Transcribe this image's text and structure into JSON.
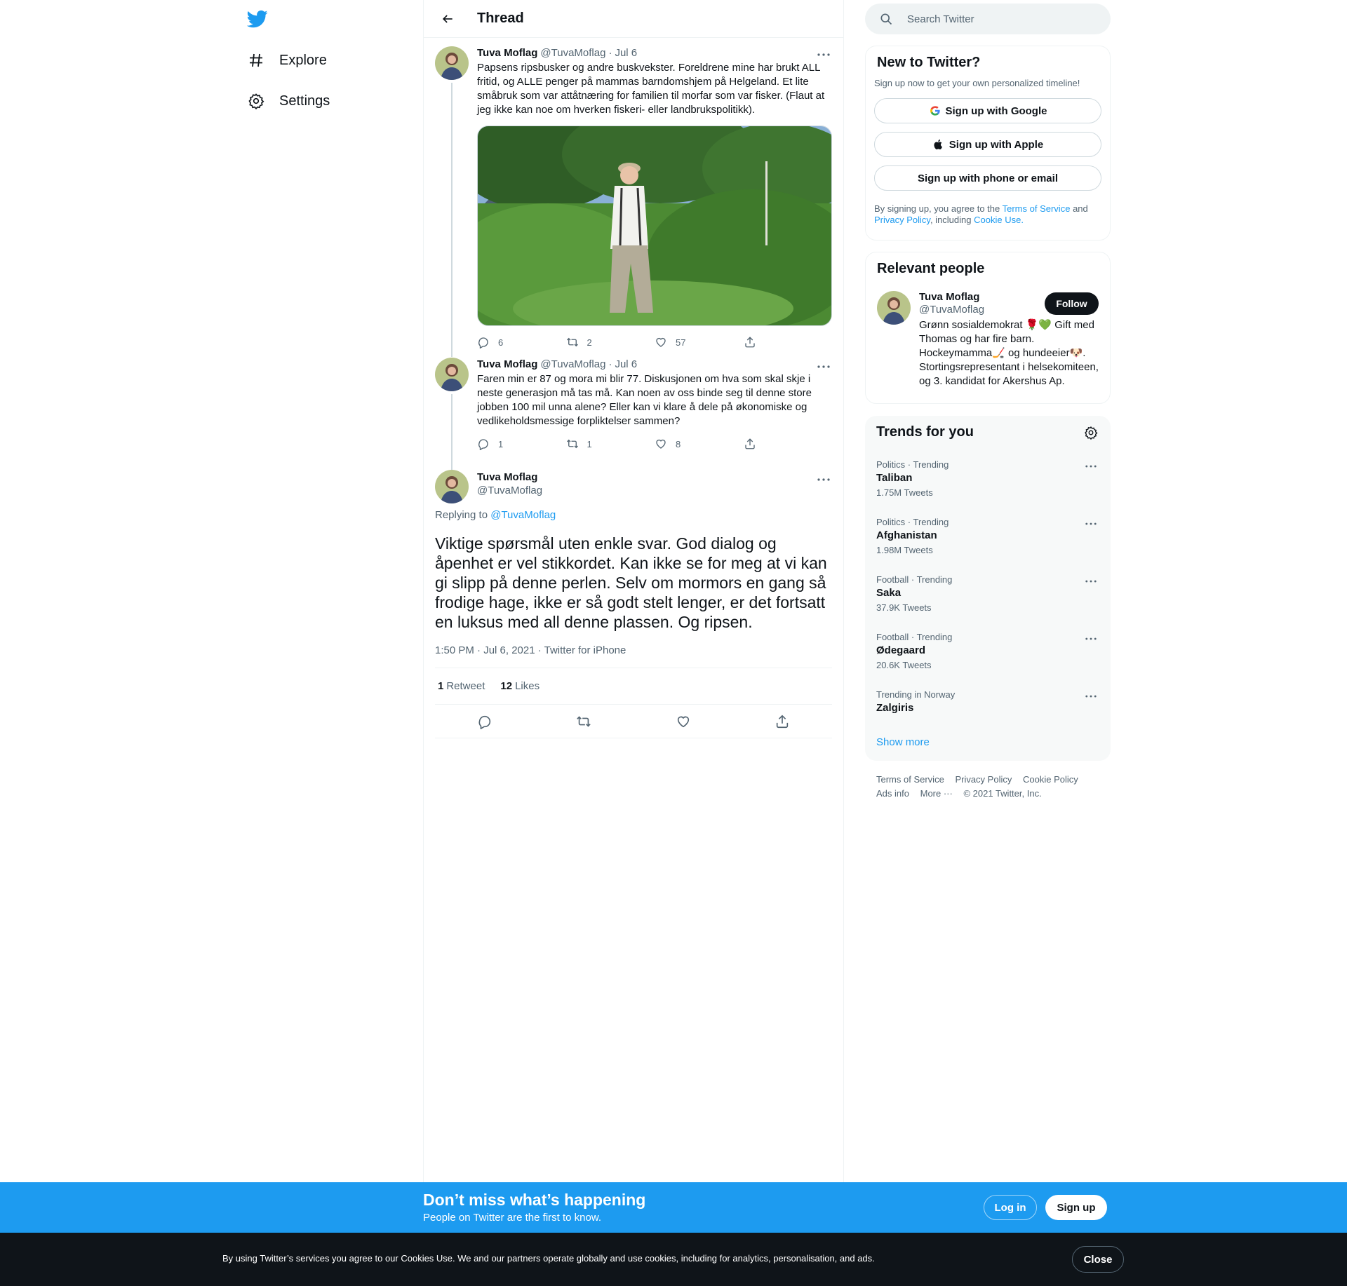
{
  "colors": {
    "brand": "#1d9bf0",
    "text": "#0f1419",
    "muted": "#536471",
    "border": "#eff3f4"
  },
  "nav": {
    "logo": "twitter-bird-icon",
    "items": [
      {
        "label": "Explore",
        "icon": "hashtag-icon"
      },
      {
        "label": "Settings",
        "icon": "gear-icon"
      }
    ]
  },
  "header": {
    "title": "Thread"
  },
  "tweets": [
    {
      "name": "Tuva Moflag",
      "handle": "@TuvaMoflag",
      "sep": "·",
      "date": "Jul 6",
      "text": "Papsens ripsbusker og andre buskvekster. Foreldrene mine har brukt ALL fritid, og ALLE penger på mammas barndomshjem på Helgeland. Et lite småbruk som var attåtnæring for familien til morfar som var fisker. (Flaut at jeg ikke kan noe om hverken fiskeri- eller landbrukspolitikk).",
      "replies": "6",
      "retweets": "2",
      "likes": "57"
    },
    {
      "name": "Tuva Moflag",
      "handle": "@TuvaMoflag",
      "sep": "·",
      "date": "Jul 6",
      "text": "Faren min er 87 og mora mi blir 77. Diskusjonen om hva som skal skje i neste generasjon må tas må. Kan noen av oss binde seg til denne store jobben 100 mil unna alene? Eller kan vi klare å dele på økonomiske og vedlikeholdsmessige forpliktelser sammen?",
      "replies": "1",
      "retweets": "1",
      "likes": "8"
    }
  ],
  "focal": {
    "name": "Tuva Moflag",
    "handle": "@TuvaMoflag",
    "replying_prefix": "Replying to",
    "replying_handle": "@TuvaMoflag",
    "text": "Viktige spørsmål uten enkle svar. God dialog og åpenhet er vel stikkordet. Kan ikke se for meg at vi kan gi slipp på denne perlen. Selv om mormors en gang så frodige hage, ikke er så godt stelt lenger, er det fortsatt en luksus med all denne plassen. Og ripsen.",
    "meta": "1:50 PM · Jul 6, 2021 · Twitter for iPhone",
    "retweet_count": "1",
    "retweet_label": "Retweet",
    "like_count": "12",
    "like_label": "Likes"
  },
  "search": {
    "placeholder": "Search Twitter"
  },
  "new_to_twitter": {
    "title": "New to Twitter?",
    "subtitle": "Sign up now to get your own personalized timeline!",
    "google": "Sign up with Google",
    "apple": "Sign up with Apple",
    "phone": "Sign up with phone or email",
    "legal_1": "By signing up, you agree to the",
    "tos": "Terms of Service",
    "legal_2": "and",
    "privacy": "Privacy Policy",
    "legal_3": ", including",
    "cookie": "Cookie Use."
  },
  "relevant": {
    "title": "Relevant people",
    "name": "Tuva Moflag",
    "handle": "@TuvaMoflag",
    "follow": "Follow",
    "bio": "Grønn sosialdemokrat 🌹💚 Gift med Thomas og har fire barn. Hockeymamma🏒 og hundeeier🐶. Stortingsrepresentant i helsekomiteen, og 3. kandidat for Akershus Ap."
  },
  "trends": {
    "title": "Trends for you",
    "items": [
      {
        "meta": "Politics · Trending",
        "topic": "Taliban",
        "count": "1.75M Tweets"
      },
      {
        "meta": "Politics · Trending",
        "topic": "Afghanistan",
        "count": "1.98M Tweets"
      },
      {
        "meta": "Football · Trending",
        "topic": "Saka",
        "count": "37.9K Tweets"
      },
      {
        "meta": "Football · Trending",
        "topic": "Ødegaard",
        "count": "20.6K Tweets"
      },
      {
        "meta": "Trending in Norway",
        "topic": "Zalgiris",
        "count": ""
      }
    ],
    "show_more": "Show more"
  },
  "footer": {
    "terms": "Terms of Service",
    "privacy": "Privacy Policy",
    "cookie": "Cookie Policy",
    "ads": "Ads info",
    "more": "More ···",
    "copyright": "© 2021 Twitter, Inc."
  },
  "banner": {
    "title": "Don’t miss what’s happening",
    "subtitle": "People on Twitter are the first to know.",
    "login": "Log in",
    "signup": "Sign up"
  },
  "cookie_bar": {
    "text": "By using Twitter’s services you agree to our Cookies Use. We and our partners operate globally and use cookies, including for analytics, personalisation, and ads.",
    "close": "Close"
  }
}
